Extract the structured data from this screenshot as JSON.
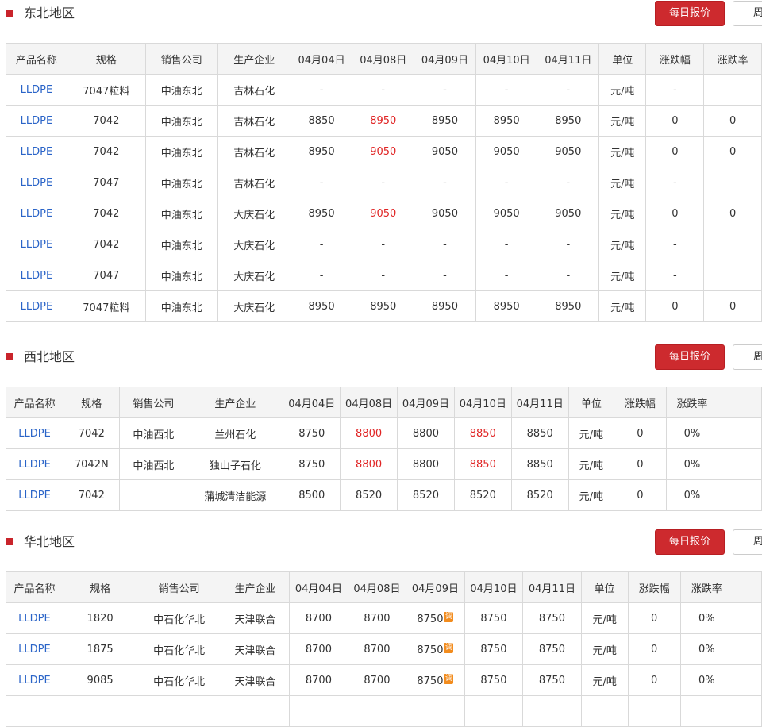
{
  "buttons": {
    "daily": "每日报价",
    "weekly": "周"
  },
  "colors": {
    "accent_red": "#cd2a2e",
    "product_link": "#2a64c8",
    "price_up": "#e02424",
    "adjust_badge": "#f28c1e"
  },
  "adjust_badge": "调",
  "sections": [
    {
      "title": "东北地区",
      "headers": [
        "产品名称",
        "规格",
        "销售公司",
        "生产企业",
        "04月04日",
        "04月08日",
        "04月09日",
        "04月10日",
        "04月11日",
        "单位",
        "涨跌幅",
        "涨跌率"
      ],
      "rows": [
        [
          "LLDPE",
          "7047粒料",
          "中油东北",
          "吉林石化",
          "-",
          "-",
          "-",
          "-",
          "-",
          "元/吨",
          "-",
          ""
        ],
        [
          "LLDPE",
          "7042",
          "中油东北",
          "吉林石化",
          "8850",
          "8950",
          "8950",
          "8950",
          "8950",
          "元/吨",
          "0",
          "0"
        ],
        [
          "LLDPE",
          "7042",
          "中油东北",
          "吉林石化",
          "8950",
          "9050",
          "9050",
          "9050",
          "9050",
          "元/吨",
          "0",
          "0"
        ],
        [
          "LLDPE",
          "7047",
          "中油东北",
          "吉林石化",
          "-",
          "-",
          "-",
          "-",
          "-",
          "元/吨",
          "-",
          ""
        ],
        [
          "LLDPE",
          "7042",
          "中油东北",
          "大庆石化",
          "8950",
          "9050",
          "9050",
          "9050",
          "9050",
          "元/吨",
          "0",
          "0"
        ],
        [
          "LLDPE",
          "7042",
          "中油东北",
          "大庆石化",
          "-",
          "-",
          "-",
          "-",
          "-",
          "元/吨",
          "-",
          ""
        ],
        [
          "LLDPE",
          "7047",
          "中油东北",
          "大庆石化",
          "-",
          "-",
          "-",
          "-",
          "-",
          "元/吨",
          "-",
          ""
        ],
        [
          "LLDPE",
          "7047粒料",
          "中油东北",
          "大庆石化",
          "8950",
          "8950",
          "8950",
          "8950",
          "8950",
          "元/吨",
          "0",
          "0"
        ]
      ]
    },
    {
      "title": "西北地区",
      "headers": [
        "产品名称",
        "规格",
        "销售公司",
        "生产企业",
        "04月04日",
        "04月08日",
        "04月09日",
        "04月10日",
        "04月11日",
        "单位",
        "涨跌幅",
        "涨跌率",
        ""
      ],
      "rows": [
        [
          "LLDPE",
          "7042",
          "中油西北",
          "兰州石化",
          "8750",
          "8800",
          "8800",
          "8850",
          "8850",
          "元/吨",
          "0",
          "0%",
          ""
        ],
        [
          "LLDPE",
          "7042N",
          "中油西北",
          "独山子石化",
          "8750",
          "8800",
          "8800",
          "8850",
          "8850",
          "元/吨",
          "0",
          "0%",
          ""
        ],
        [
          "LLDPE",
          "7042",
          "",
          "蒲城清洁能源",
          "8500",
          "8520",
          "8520",
          "8520",
          "8520",
          "元/吨",
          "0",
          "0%",
          ""
        ]
      ]
    },
    {
      "title": "华北地区",
      "headers": [
        "产品名称",
        "规格",
        "销售公司",
        "生产企业",
        "04月04日",
        "04月08日",
        "04月09日",
        "04月10日",
        "04月11日",
        "单位",
        "涨跌幅",
        "涨跌率",
        ""
      ],
      "rows": [
        [
          "LLDPE",
          "1820",
          "中石化华北",
          "天津联合",
          "8700",
          "8700",
          "8750",
          "8750",
          "8750",
          "元/吨",
          "0",
          "0%",
          ""
        ],
        [
          "LLDPE",
          "1875",
          "中石化华北",
          "天津联合",
          "8700",
          "8700",
          "8750",
          "8750",
          "8750",
          "元/吨",
          "0",
          "0%",
          ""
        ],
        [
          "LLDPE",
          "9085",
          "中石化华北",
          "天津联合",
          "8700",
          "8700",
          "8750",
          "8750",
          "8750",
          "元/吨",
          "0",
          "0%",
          ""
        ],
        [
          "",
          "",
          "",
          "",
          "",
          "",
          "",
          "",
          "",
          "",
          "",
          "",
          ""
        ]
      ]
    }
  ]
}
